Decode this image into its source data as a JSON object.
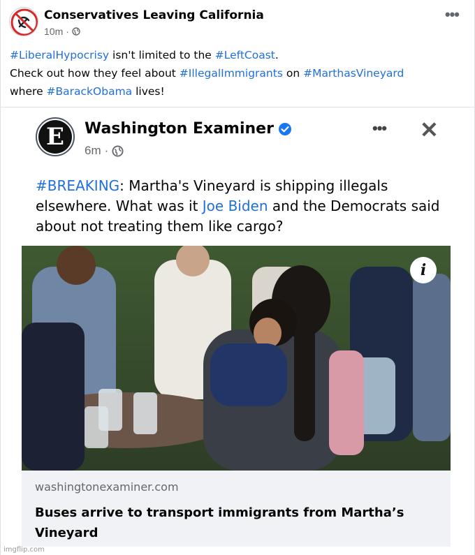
{
  "outer_post": {
    "author": "Conservatives Leaving California",
    "time": "10m",
    "separator": "·",
    "more_label": "•••",
    "text": {
      "tag1": "#LiberalHypocrisy",
      "part1": " isn't limited to the ",
      "tag2": "#LeftCoast",
      "part2": ".",
      "part3": "Check out how they feel about ",
      "tag3": "#IllegalImmigrants",
      "part4": " on ",
      "tag4": "#MarthasVineyard",
      "part5": "where ",
      "tag5": "#BarackObama",
      "part6": " lives!"
    }
  },
  "shared_post": {
    "author": "Washington Examiner",
    "avatar_letter": "E",
    "time": "6m",
    "separator": "·",
    "more_label": "•••",
    "close_label": "✕",
    "text": {
      "tag": "#BREAKING",
      "part1": ": Martha's Vineyard is shipping illegals elsewhere. What was it ",
      "name": "Joe Biden",
      "part2": " and the Democrats said about not treating them like cargo?"
    },
    "info_label": "i",
    "link": {
      "domain": "washingtonexaminer.com",
      "title": "Buses arrive to transport immigrants from Martha’s Vineyard"
    }
  },
  "watermark": "imgflip.com",
  "colors": {
    "hashtag": "#216fdb",
    "meta": "#65676b",
    "verified": "#1877f2",
    "link_bg": "#f0f2f5"
  }
}
